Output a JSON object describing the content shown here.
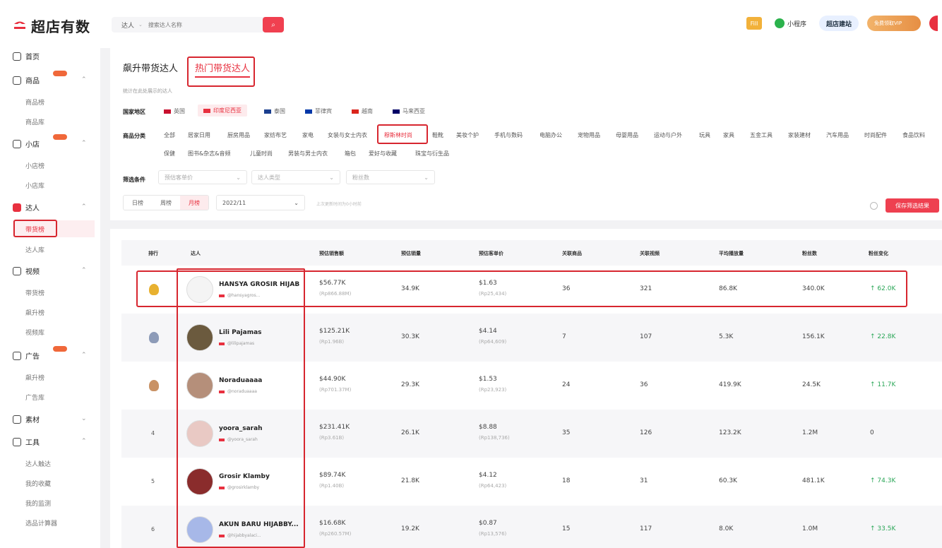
{
  "brand": {
    "name": "超店有数"
  },
  "search": {
    "type": "达人",
    "placeholder": "搜索达人名称"
  },
  "topbar": {
    "fill_badge": "Fill",
    "mini_program": "小程序",
    "jianzhan": "超店建站",
    "vip": "免费领取VIP"
  },
  "sidebar": {
    "home": "首页",
    "goods": "商品",
    "goods_subs": [
      "商品榜",
      "商品库"
    ],
    "shop": "小店",
    "shop_subs": [
      "小店榜",
      "小店库"
    ],
    "kol": "达人",
    "kol_subs": [
      "带货榜",
      "达人库"
    ],
    "video": "视频",
    "video_subs": [
      "带货榜",
      "飙升榜",
      "视频库"
    ],
    "ads": "广告",
    "ads_subs": [
      "飙升榜",
      "广告库"
    ],
    "material": "素材",
    "tools": "工具",
    "tools_subs": [
      "达人触达",
      "我的收藏",
      "我的监测",
      "选品计算器"
    ]
  },
  "tabs": [
    "飙升带货达人",
    "热门带货达人"
  ],
  "hint": "统计在此处展示的达人",
  "filters": {
    "region_label": "国家地区",
    "regions": [
      "英国",
      "印度尼西亚",
      "泰国",
      "菲律宾",
      "越南",
      "马来西亚"
    ],
    "category_label": "商品分类",
    "categories_row1": [
      "全部",
      "居家日用",
      "厨房用品",
      "家纺布艺",
      "家电",
      "女装与女士内衣",
      "穆斯林时尚",
      "鞋靴",
      "美妆个护",
      "手机与数码",
      "电脑办公",
      "宠物用品",
      "母婴用品",
      "运动与户外",
      "玩具",
      "家具",
      "五金工具",
      "家装建材",
      "汽车用品",
      "时尚配件",
      "食品饮料"
    ],
    "categories_row2": [
      "保健",
      "图书&杂志&音频",
      "儿童时尚",
      "男装与男士内衣",
      "箱包",
      "爱好与收藏",
      "珠宝与衍生品"
    ],
    "condition_label": "筛选条件",
    "conditions": [
      "预估客单价",
      "达人类型",
      "粉丝数"
    ],
    "periods": [
      "日榜",
      "周榜",
      "月榜"
    ],
    "month": "2022/11",
    "note": "上次更新时间为0小时前",
    "save_button": "保存筛选结果"
  },
  "table": {
    "headers": [
      "排行",
      "达人",
      "预估销售额",
      "预估销量",
      "预估客单价",
      "关联商品",
      "关联视频",
      "平均播放量",
      "粉丝数",
      "粉丝变化"
    ],
    "rows": [
      {
        "rank": "",
        "name": "HANSYA GROSIR HIJAB",
        "handle": "@hansyagros...",
        "sales": "$56.77K",
        "sales_sub": "(Rp866.88M)",
        "volume": "34.9K",
        "price": "$1.63",
        "price_sub": "(Rp25,434)",
        "goods": "36",
        "videos": "321",
        "views": "86.8K",
        "fans": "340.0K",
        "fans_change": "↑ 62.0K"
      },
      {
        "rank": "",
        "name": "Lili Pajamas",
        "handle": "@lilipajamas",
        "sales": "$125.21K",
        "sales_sub": "(Rp1.96B)",
        "volume": "30.3K",
        "price": "$4.14",
        "price_sub": "(Rp64,609)",
        "goods": "7",
        "videos": "107",
        "views": "5.3K",
        "fans": "156.1K",
        "fans_change": "↑ 22.8K"
      },
      {
        "rank": "",
        "name": "Noraduaaaa",
        "handle": "@noraduaaaa",
        "sales": "$44.90K",
        "sales_sub": "(Rp701.37M)",
        "volume": "29.3K",
        "price": "$1.53",
        "price_sub": "(Rp23,923)",
        "goods": "24",
        "videos": "36",
        "views": "419.9K",
        "fans": "24.5K",
        "fans_change": "↑ 11.7K"
      },
      {
        "rank": "4",
        "name": "yoora_sarah",
        "handle": "@yoora_sarah",
        "sales": "$231.41K",
        "sales_sub": "(Rp3.61B)",
        "volume": "26.1K",
        "price": "$8.88",
        "price_sub": "(Rp138,736)",
        "goods": "35",
        "videos": "126",
        "views": "123.2K",
        "fans": "1.2M",
        "fans_change": "0"
      },
      {
        "rank": "5",
        "name": "Grosir Klamby",
        "handle": "@grosirklamby",
        "sales": "$89.74K",
        "sales_sub": "(Rp1.40B)",
        "volume": "21.8K",
        "price": "$4.12",
        "price_sub": "(Rp64,423)",
        "goods": "18",
        "videos": "31",
        "views": "60.3K",
        "fans": "481.1K",
        "fans_change": "↑ 74.3K"
      },
      {
        "rank": "6",
        "name": "AKUN BARU HIJABBY...",
        "handle": "@hijabbyalaci...",
        "sales": "$16.68K",
        "sales_sub": "(Rp260.57M)",
        "volume": "19.2K",
        "price": "$0.87",
        "price_sub": "(Rp13,576)",
        "goods": "15",
        "videos": "117",
        "views": "8.0K",
        "fans": "1.0M",
        "fans_change": "↑ 33.5K"
      }
    ]
  },
  "colors": {
    "accent": "#e8303f",
    "gold": "#e8b130",
    "silver": "#8d9bb8",
    "bronze": "#c99265",
    "up": "#2aa657"
  }
}
